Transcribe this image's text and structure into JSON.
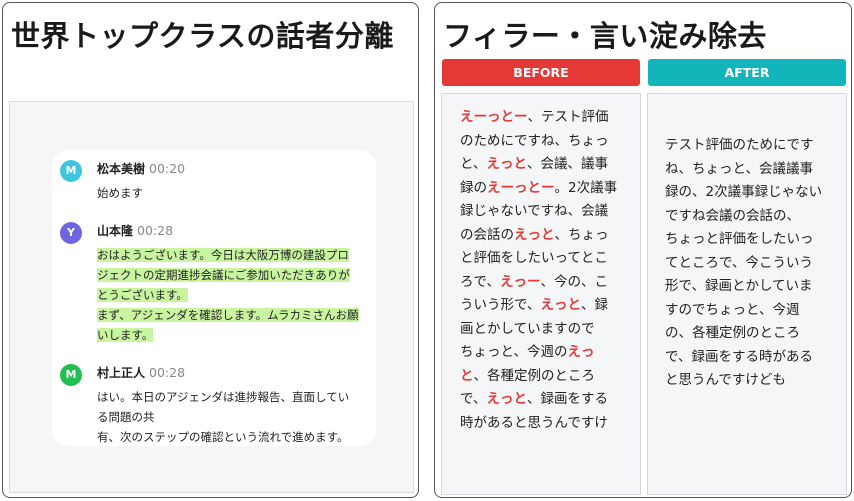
{
  "left": {
    "title": "世界トップクラスの話者分離",
    "messages": [
      {
        "avatar": "M",
        "color": "#3ec6e0",
        "name": "松本美樹",
        "time": "00:20",
        "lines": [
          {
            "text": "始めます",
            "hl": false
          }
        ]
      },
      {
        "avatar": "Y",
        "color": "#7065e0",
        "name": "山本隆",
        "time": "00:28",
        "lines": [
          {
            "text": "おはようございます。今日は大阪万博の建設プロ",
            "hl": true
          },
          {
            "text": "ジェクトの定期進捗会議にご参加いただきありが",
            "hl": true
          },
          {
            "text": "とうございます。",
            "hl": true
          },
          {
            "text": "まず、アジェンダを確認します。ムラカミさんお願",
            "hl": true
          },
          {
            "text": "いします。",
            "hl": true
          }
        ]
      },
      {
        "avatar": "M",
        "color": "#1fbf52",
        "name": "村上正人",
        "time": "00:28",
        "lines": [
          {
            "text": "はい。本日のアジェンダは進捗報告、直面してい",
            "hl": false
          },
          {
            "text": "る問題の共",
            "hl": false
          },
          {
            "text": "有、次のステップの確認という流れで進めます。",
            "hl": false
          }
        ]
      }
    ]
  },
  "right": {
    "title": "フィラー・言い淀み除去",
    "before_label": "BEFORE",
    "after_label": "AFTER",
    "filler_color": "#e53935",
    "before_lines": [
      [
        {
          "t": "えーっとー",
          "f": true
        },
        {
          "t": "、テスト評価",
          "f": false
        }
      ],
      [
        {
          "t": "のためにですね、ちょっ",
          "f": false
        }
      ],
      [
        {
          "t": "と、",
          "f": false
        },
        {
          "t": "えっと",
          "f": true
        },
        {
          "t": "、会議、議事",
          "f": false
        }
      ],
      [
        {
          "t": "録の",
          "f": false
        },
        {
          "t": "えーっとー",
          "f": true
        },
        {
          "t": "。2次議事",
          "f": false
        }
      ],
      [
        {
          "t": "録じゃないですね、会議",
          "f": false
        }
      ],
      [
        {
          "t": "の会話の",
          "f": false
        },
        {
          "t": "えっと",
          "f": true
        },
        {
          "t": "、ちょっ",
          "f": false
        }
      ],
      [
        {
          "t": "と評価をしたいってとこ",
          "f": false
        }
      ],
      [
        {
          "t": "ろで、",
          "f": false
        },
        {
          "t": "えっー",
          "f": true
        },
        {
          "t": "、今の、こ",
          "f": false
        }
      ],
      [
        {
          "t": "ういう形で、",
          "f": false
        },
        {
          "t": "えっと",
          "f": true
        },
        {
          "t": "、録",
          "f": false
        }
      ],
      [
        {
          "t": "画とかしていますので",
          "f": false
        }
      ],
      [
        {
          "t": "ちょっと、今週の",
          "f": false
        },
        {
          "t": "えっ",
          "f": true
        }
      ],
      [
        {
          "t": "と",
          "f": true
        },
        {
          "t": "、各種定例のところ",
          "f": false
        }
      ],
      [
        {
          "t": "で、",
          "f": false
        },
        {
          "t": "えっと",
          "f": true
        },
        {
          "t": "、録画をする",
          "f": false
        }
      ],
      [
        {
          "t": "時があると思うんですけ",
          "f": false
        }
      ]
    ],
    "after_lines": [
      "テスト評価のためにです",
      "ね、ちょっと、会議議事",
      "録の、2次議事録じゃない",
      "ですね会議の会話の、",
      "ちょっと評価をしたいっ",
      "てところで、今こういう",
      "形で、録画とかしていま",
      "すのでちょっと、今週",
      "の、各種定例のところ",
      "で、録画をする時がある",
      "と思うんですけども"
    ]
  }
}
